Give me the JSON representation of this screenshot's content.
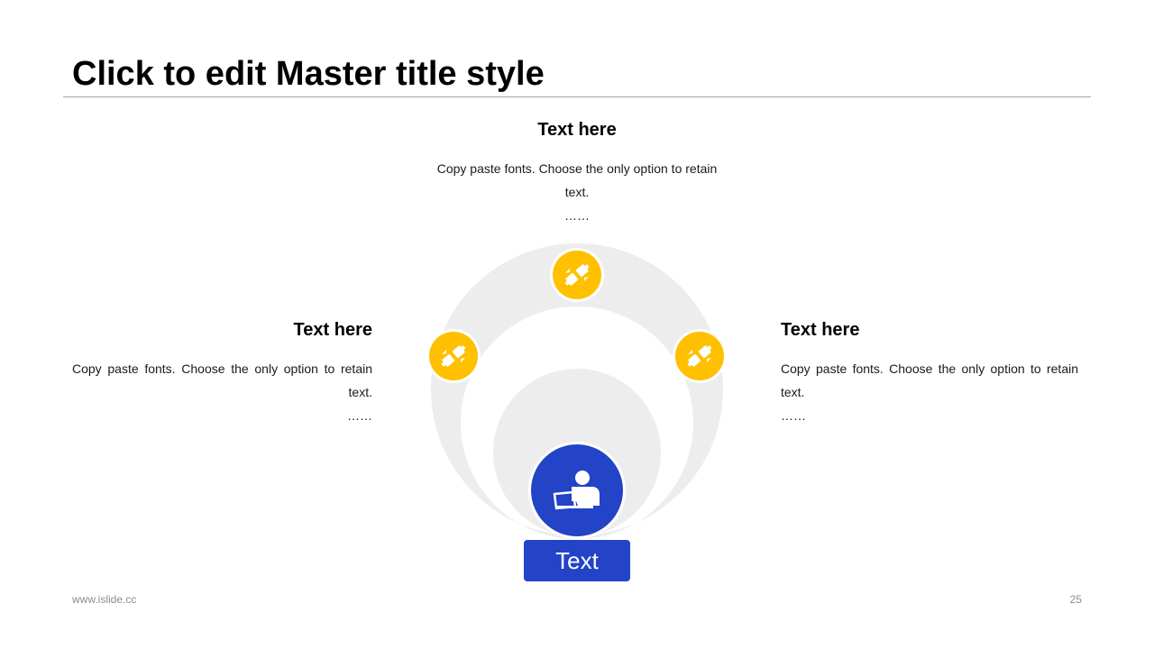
{
  "slide": {
    "title": "Click to edit Master title style",
    "page_number": "25",
    "footer_url": "www.islide.cc"
  },
  "colors": {
    "accent_yellow": "#FFC000",
    "accent_blue": "#2344C6",
    "ring_gray": "#EDEDED",
    "rule_gray": "#A6A6A6"
  },
  "blocks": {
    "top": {
      "heading": "Text here",
      "body": "Copy paste fonts. Choose the only option to retain text.",
      "ellipsis": "……"
    },
    "left": {
      "heading": "Text here",
      "body": "Copy paste fonts. Choose the only option to retain text.",
      "ellipsis": "……"
    },
    "right": {
      "heading": "Text here",
      "body": "Copy paste fonts. Choose the only option to retain text.",
      "ellipsis": "……"
    }
  },
  "center": {
    "label": "Text",
    "icon": "person-with-laptop-icon"
  },
  "nodes": [
    {
      "name": "node-left",
      "icon": "seatbelt-buckle-icon"
    },
    {
      "name": "node-top",
      "icon": "seatbelt-buckle-icon"
    },
    {
      "name": "node-right",
      "icon": "seatbelt-buckle-icon"
    }
  ]
}
